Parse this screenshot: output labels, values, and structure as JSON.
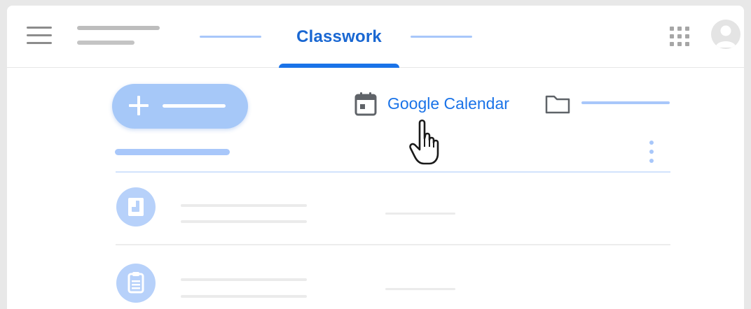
{
  "header": {
    "active_tab": "Classwork"
  },
  "toolbar": {
    "calendar_link_label": "Google Calendar"
  },
  "icons": {
    "menu": "menu-icon",
    "apps": "apps-grid-icon",
    "avatar": "account-avatar",
    "create": "plus-icon",
    "calendar": "calendar-icon",
    "folder": "folder-icon",
    "more": "more-vert-icon",
    "assignment": "assignment-icon",
    "question": "clipboard-icon",
    "cursor": "hand-pointer-cursor"
  },
  "colors": {
    "accent": "#1a73e8",
    "tab_text": "#1967d2",
    "placeholder_blue": "#a8c7fa",
    "create_button": "#a6c8f8"
  }
}
